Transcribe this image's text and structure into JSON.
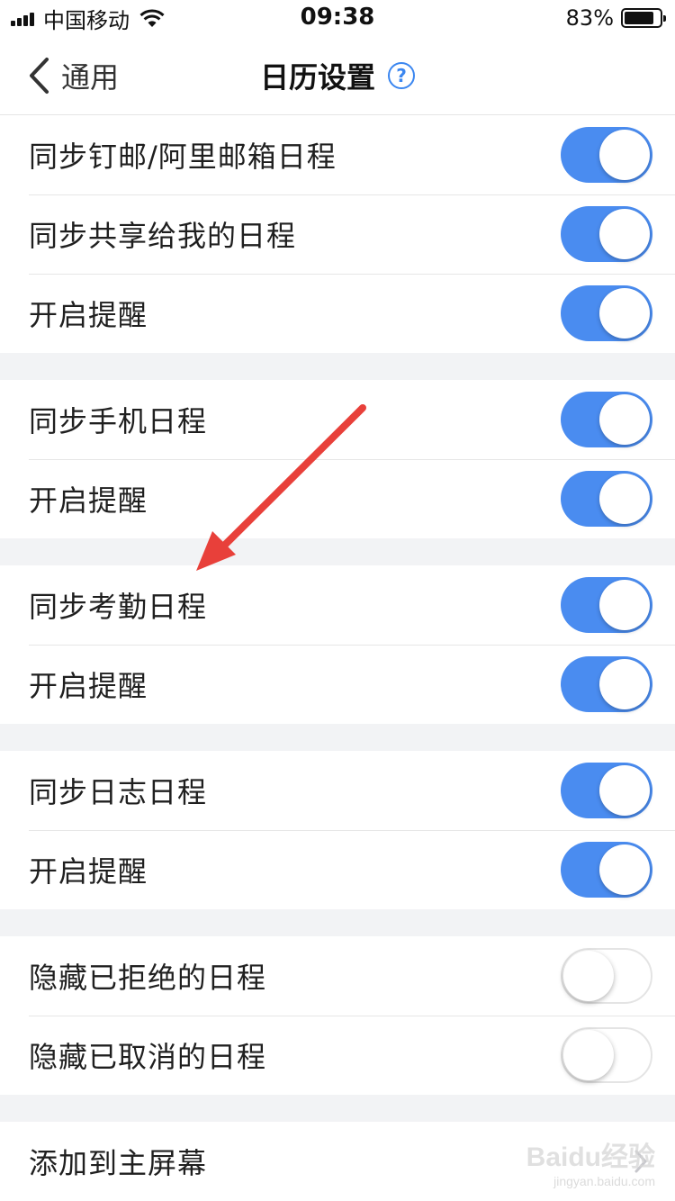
{
  "status_bar": {
    "carrier": "中国移动",
    "time": "09:38",
    "battery": "83%",
    "battery_level": 0.83
  },
  "nav": {
    "back_label": "通用",
    "title": "日历设置",
    "help_glyph": "?"
  },
  "groups": [
    {
      "rows": [
        {
          "label": "同步钉邮/阿里邮箱日程",
          "on": true
        },
        {
          "label": "同步共享给我的日程",
          "on": true
        },
        {
          "label": "开启提醒",
          "on": true
        }
      ]
    },
    {
      "rows": [
        {
          "label": "同步手机日程",
          "on": true
        },
        {
          "label": "开启提醒",
          "on": true
        }
      ]
    },
    {
      "rows": [
        {
          "label": "同步考勤日程",
          "on": true
        },
        {
          "label": "开启提醒",
          "on": true
        }
      ]
    },
    {
      "rows": [
        {
          "label": "同步日志日程",
          "on": true
        },
        {
          "label": "开启提醒",
          "on": true
        }
      ]
    },
    {
      "rows": [
        {
          "label": "隐藏已拒绝的日程",
          "on": false
        },
        {
          "label": "隐藏已取消的日程",
          "on": false
        }
      ]
    },
    {
      "rows": [
        {
          "label": "添加到主屏幕",
          "chevron": true
        }
      ]
    }
  ],
  "watermark": {
    "top": "Baidu经验",
    "bottom": "jingyan.baidu.com"
  },
  "colors": {
    "accent": "#4a8cf0",
    "annotation": "#e8403a"
  }
}
